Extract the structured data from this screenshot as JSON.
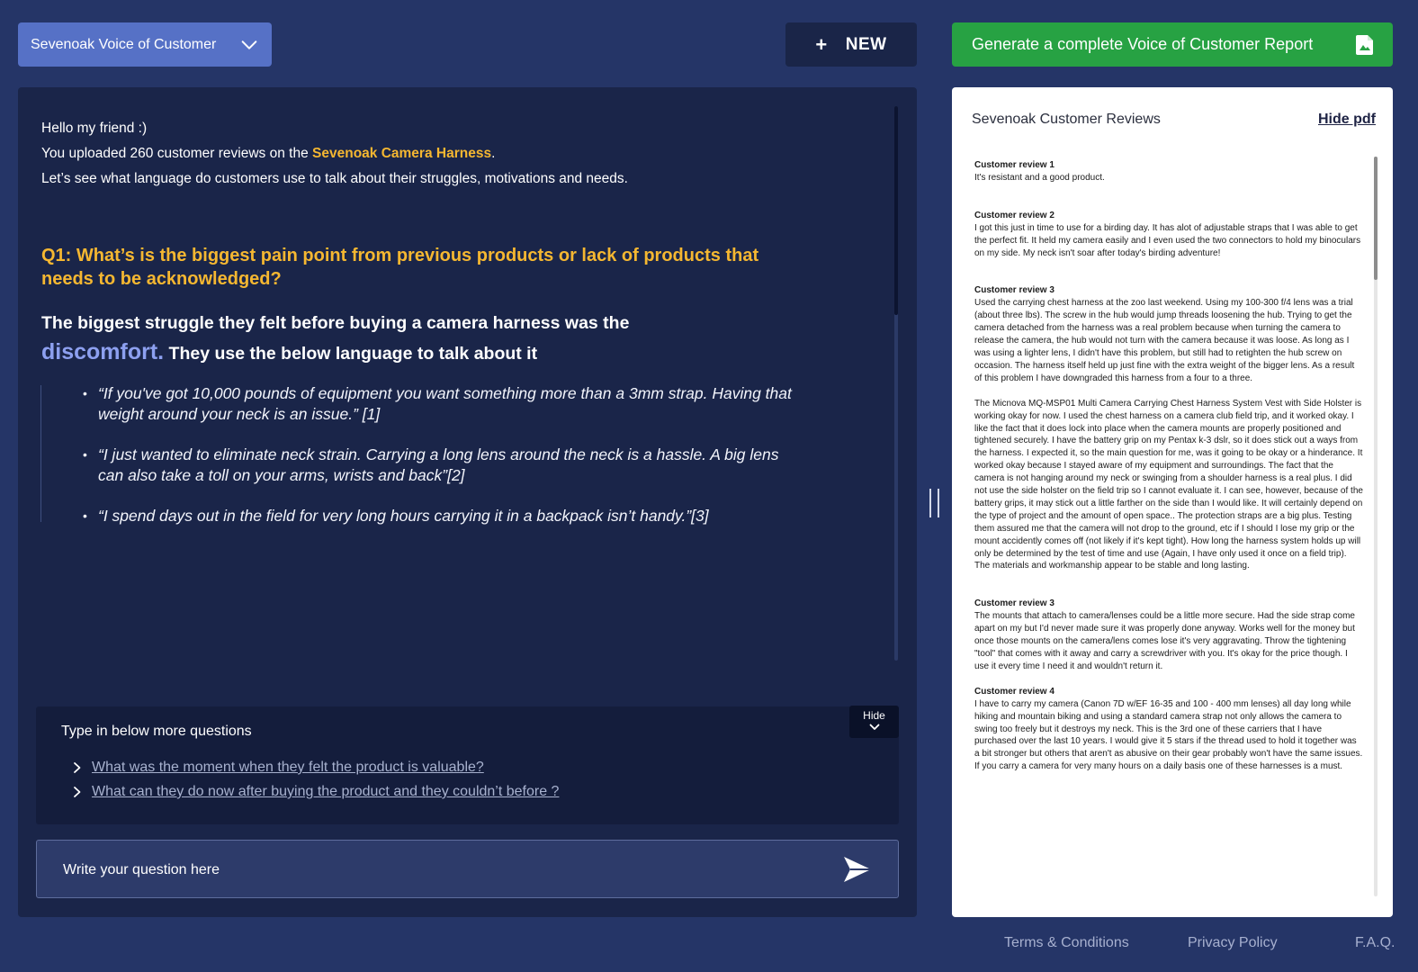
{
  "header": {
    "project_select": "Sevenoak Voice of Customer",
    "new_button": "NEW",
    "report_button": "Generate a complete Voice of Customer Report"
  },
  "chat": {
    "intro_line1": "Hello my friend :)",
    "intro_line2_prefix": "You uploaded 260 customer reviews on the ",
    "product_name": "Sevenoak Camera Harness",
    "intro_line2_suffix": ".",
    "intro_line3": "Let’s see what language do customers use to talk about their struggles, motivations and needs.",
    "question": "Q1: What’s is the biggest pain point from previous products or lack of products that needs to be acknowledged?",
    "answer_prefix": "The biggest struggle they felt before buying a camera harness was the",
    "answer_keyword": "discomfort.",
    "answer_suffix": "They use the below language to talk about it",
    "quotes": [
      "“If you've got 10,000 pounds of equipment you want something more than a 3mm strap. Having that weight around your neck is an issue.” [1]",
      "“I just wanted to eliminate neck strain. Carrying a long lens around the neck is a hassle. A big lens can also take a toll on your arms, wrists and back”[2]",
      "“I spend days out in the field for very long hours carrying it in a backpack isn’t handy.”[3]"
    ]
  },
  "suggestions": {
    "title": "Type in below more questions",
    "hide_label": "Hide",
    "items": [
      "What was the moment when they felt the product is valuable?",
      "What can they do now after buying the product and they couldn’t before ?"
    ]
  },
  "input": {
    "placeholder": "Write your question here"
  },
  "pdf": {
    "title": "Sevenoak Customer Reviews",
    "hide_link": "Hide pdf",
    "reviews": [
      {
        "heading": "Customer review 1",
        "paragraphs": [
          "It's resistant and a good product."
        ]
      },
      {
        "heading": "Customer review 2",
        "paragraphs": [
          "I got this just in time to use for a birding day. It has alot of adjustable straps that I was able to get the perfect fit. It held my camera easily and I even used the two connectors to hold my binoculars on my side. My neck isn't soar after today's birding adventure!"
        ]
      },
      {
        "heading": "Customer review 3",
        "paragraphs": [
          "Used the carrying chest harness at the zoo last weekend. Using my 100-300 f/4 lens was a trial (about three lbs). The screw in the hub would jump threads loosening the hub. Trying to get the camera detached from the harness was a real problem because when turning the camera to release the camera, the hub would not turn with the camera because it was loose. As long as I was using a lighter lens, I didn't have this problem, but still had to retighten the hub screw on occasion. The harness itself held up just fine with the extra weight of the bigger lens. As a result of this problem I have downgraded this harness from a four to a three.",
          "The Micnova MQ-MSP01 Multi Camera Carrying Chest Harness System Vest with Side Holster is working okay for now. I used the chest harness on a camera club field trip, and it worked okay. I like the fact that it does lock into place when the camera mounts are properly positioned and tightened securely. I have the battery grip on my Pentax k-3 dslr, so it does stick out a ways from the harness. I expected it, so the main question for me, was it going to be okay or a hinderance. It worked okay because I stayed aware of my equipment and surroundings. The fact that the camera is not hanging around my neck or swinging from a shoulder harness is a real plus. I did not use the side holster on the field trip so I cannot evaluate it. I can see, however, because of the battery grips, it may stick out a little farther on the side than I would like. It will certainly depend on the type of project and the amount of open space.. The protection straps are a big plus. Testing them assured me that the camera will not drop to the ground, etc if I should I lose my grip or the mount accidently comes off (not likely if it's kept tight). How long the harness system holds up will only be determined by the test of time and use (Again, I have only used it once on a field trip). The materials and workmanship appear to be stable and long lasting."
        ]
      },
      {
        "heading": "Customer review 3",
        "paragraphs": [
          "The mounts that attach to camera/lenses could be a little more secure. Had the side strap come apart on my but I'd never made sure it was properly done anyway. Works well for the money but once those mounts on the camera/lens comes lose it's very aggravating. Throw the tightening \"tool\" that comes with it away and carry a screwdriver with you. It's okay for the price though. I use it every time I need it and wouldn't return it."
        ]
      },
      {
        "heading": "Customer review 4",
        "paragraphs": [
          "I have to carry my camera (Canon 7D w/EF 16-35 and 100 - 400 mm lenses) all day long while hiking and mountain biking and using a standard camera strap not only allows the camera to swing too freely but it destroys my neck. This is the 3rd one of these carriers that I have purchased over the last 10 years. I would give it 5 stars if the thread used to hold it together was a bit stronger but others that aren't as abusive on their gear probably won't have the same issues. If you carry a camera for very many hours on a daily basis one of these harnesses is a must."
        ]
      }
    ]
  },
  "footer": {
    "terms": "Terms & Conditions",
    "privacy": "Privacy Policy",
    "faq": "F.A.Q."
  }
}
